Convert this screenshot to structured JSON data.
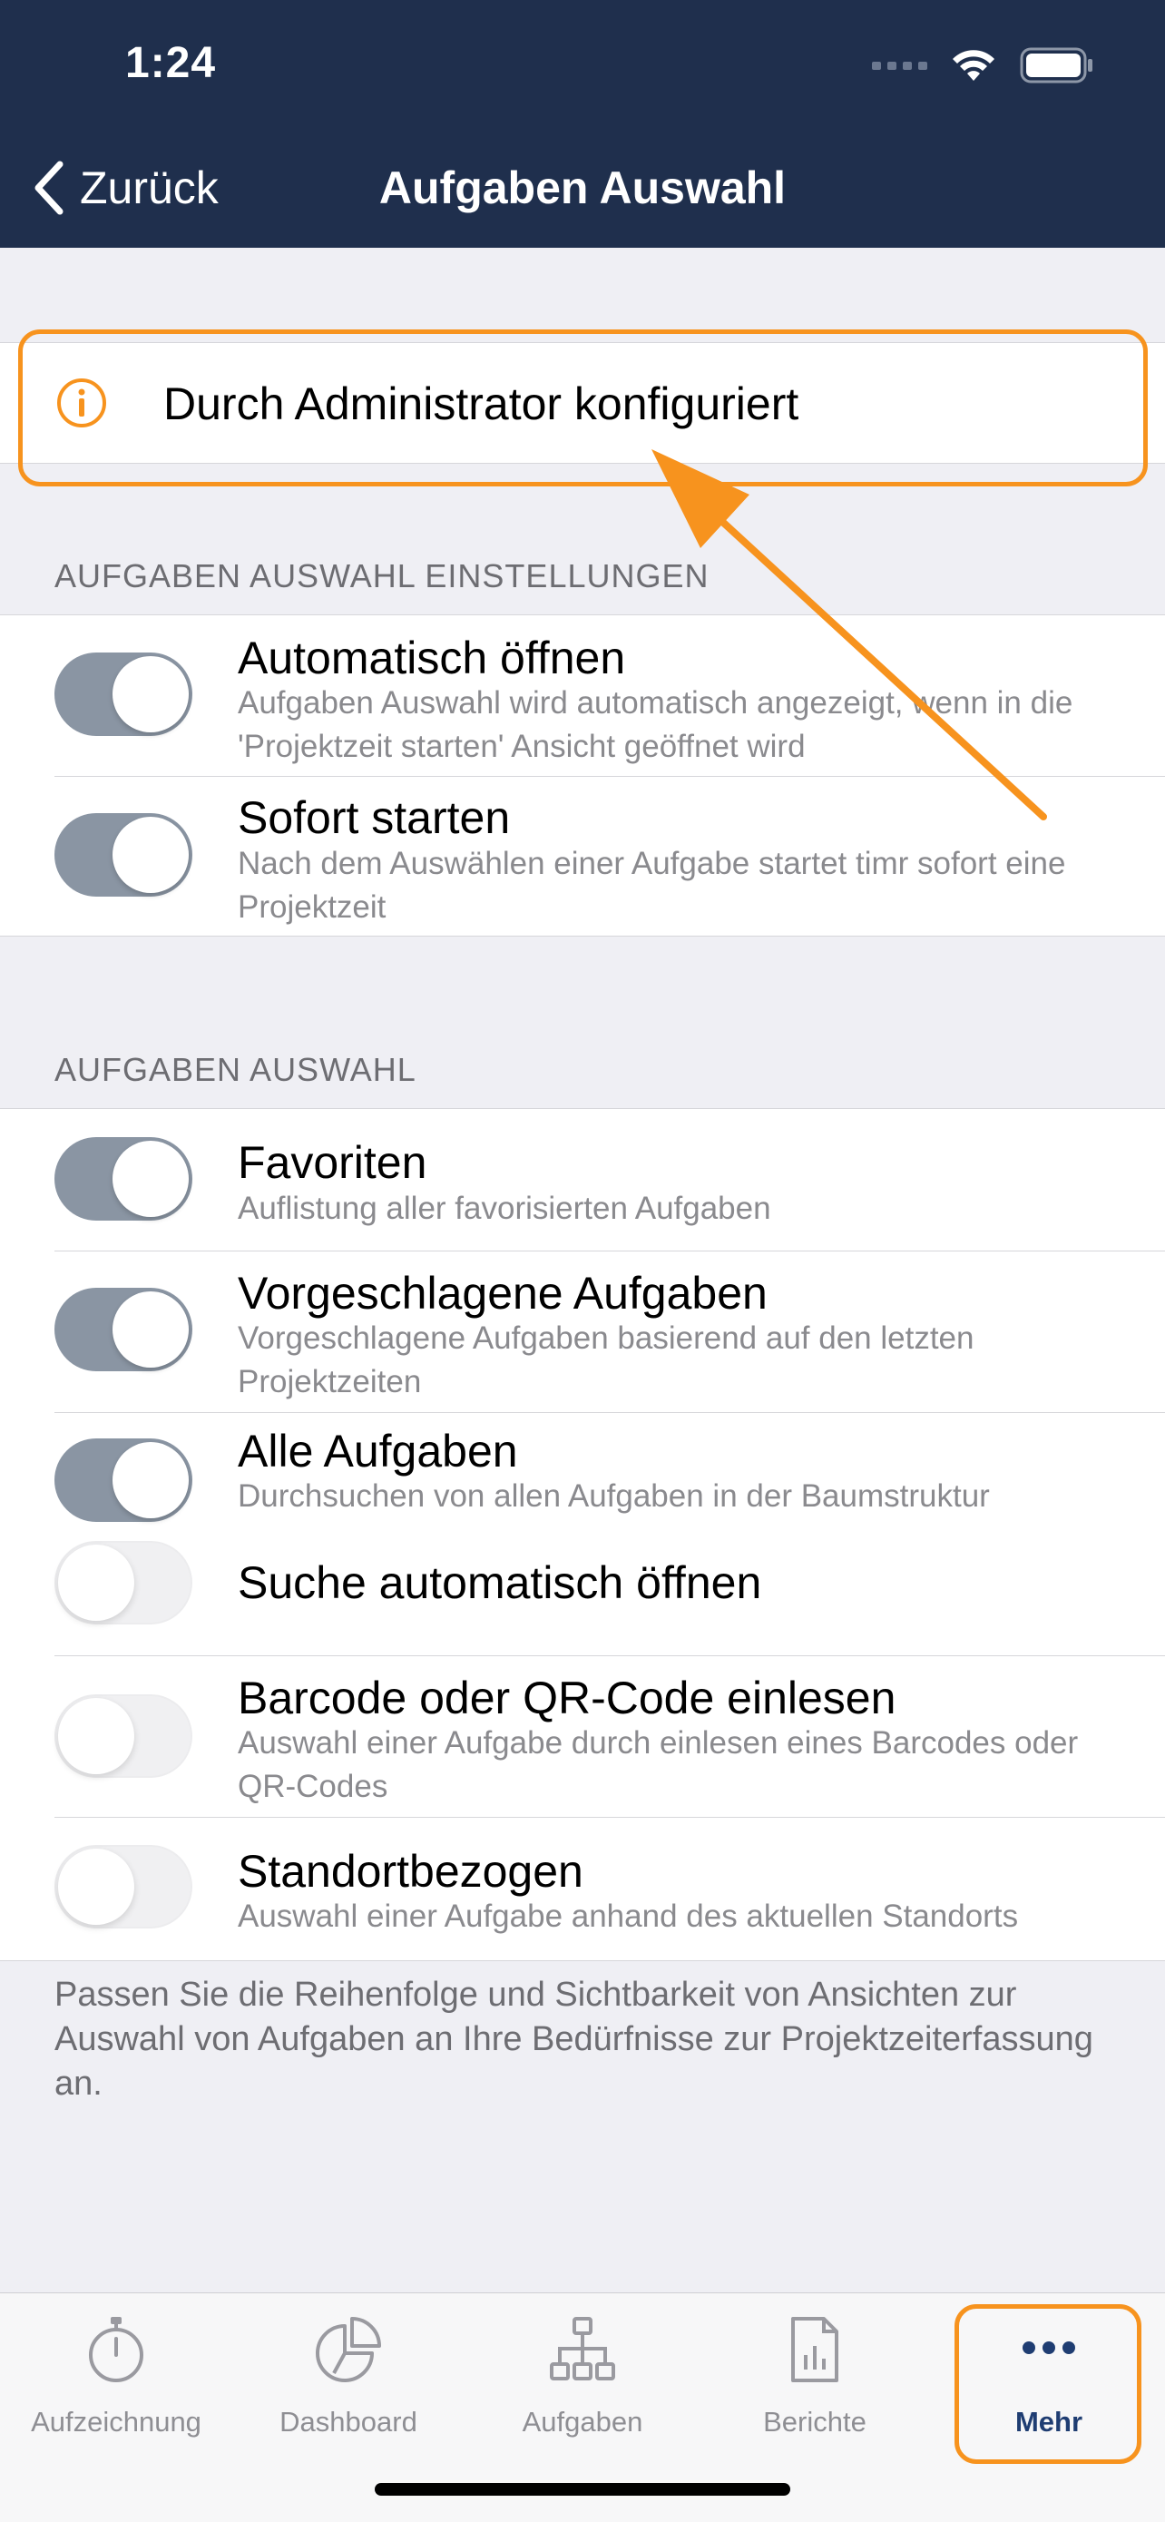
{
  "status_bar": {
    "time": "1:24"
  },
  "nav": {
    "back_label": "Zurück",
    "title": "Aufgaben Auswahl"
  },
  "info": {
    "text": "Durch Administrator konfiguriert"
  },
  "section1": {
    "header": "AUFGABEN AUSWAHL EINSTELLUNGEN",
    "rows": [
      {
        "title": "Automatisch öffnen",
        "subtitle": "Aufgaben Auswahl wird automatisch angezeigt, wenn in die 'Projektzeit starten' Ansicht geöffnet wird",
        "on": true
      },
      {
        "title": "Sofort starten",
        "subtitle": "Nach dem Auswählen einer Aufgabe startet timr sofort eine Projektzeit",
        "on": true
      }
    ]
  },
  "section2": {
    "header": "AUFGABEN AUSWAHL",
    "rows": [
      {
        "title": "Favoriten",
        "subtitle": "Auflistung aller favorisierten Aufgaben",
        "on": true
      },
      {
        "title": "Vorgeschlagene Aufgaben",
        "subtitle": "Vorgeschlagene Aufgaben basierend auf den letzten Projektzeiten",
        "on": true
      },
      {
        "title": "Alle Aufgaben",
        "subtitle": "Durchsuchen von allen Aufgaben in der Baumstruktur",
        "on": true
      },
      {
        "title": "Suche automatisch öffnen",
        "subtitle": "",
        "on": false
      },
      {
        "title": "Barcode oder QR-Code einlesen",
        "subtitle": "Auswahl einer Aufgabe durch einlesen eines Barcodes oder QR-Codes",
        "on": false
      },
      {
        "title": "Standortbezogen",
        "subtitle": "Auswahl einer Aufgabe anhand des aktuellen Standorts",
        "on": false
      }
    ]
  },
  "footer": "Passen Sie die Reihenfolge und Sichtbarkeit von Ansichten zur Auswahl von Aufgaben an Ihre Bedürfnisse zur Projektzeiterfassung an.",
  "tabs": [
    {
      "label": "Aufzeichnung",
      "icon": "stopwatch-icon"
    },
    {
      "label": "Dashboard",
      "icon": "pie-chart-icon"
    },
    {
      "label": "Aufgaben",
      "icon": "hierarchy-icon"
    },
    {
      "label": "Berichte",
      "icon": "report-icon"
    },
    {
      "label": "Mehr",
      "icon": "more-dots-icon",
      "active": true
    }
  ],
  "colors": {
    "header_bg": "#1f2f4d",
    "toggle_on": "#8a95a3",
    "highlight": "#f7931e",
    "active_tab": "#1f3d72"
  }
}
